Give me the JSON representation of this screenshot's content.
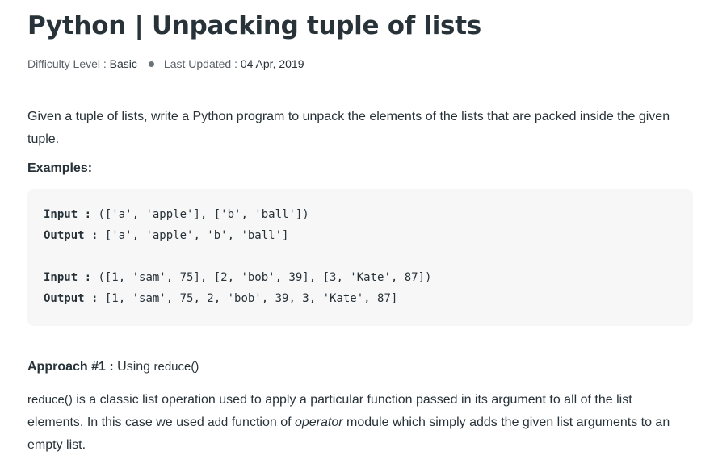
{
  "article": {
    "title": "Python | Unpacking tuple of lists",
    "meta": {
      "difficulty_label": "Difficulty Level : ",
      "difficulty_value": "Basic",
      "updated_label": "Last Updated : ",
      "updated_value": "04 Apr, 2019"
    },
    "intro": "Given a tuple of lists, write a Python program to unpack the elements of the lists that are packed inside the given tuple.",
    "examples_heading": "Examples:",
    "code": {
      "input_label": "Input :",
      "output_label": "Output :",
      "example1_input": " (['a', 'apple'], ['b', 'ball'])",
      "example1_output": " ['a', 'apple', 'b', 'ball']",
      "example2_input": " ([1, 'sam', 75], [2, 'bob', 39], [3, 'Kate', 87])",
      "example2_output": " [1, 'sam', 75, 2, 'bob', 39, 3, 'Kate', 87]"
    },
    "approach": {
      "label": "Approach #1 :",
      "text": " Using ",
      "code": "reduce()"
    },
    "approach_desc": {
      "code1": "reduce()",
      "text1": " is a classic list operation used to apply a particular function passed in its argument to all of the list elements. In this case we used ",
      "code2": "add",
      "text2": " function of ",
      "italic": "operator",
      "text3": " module which simply adds the given list arguments to an empty list."
    }
  }
}
